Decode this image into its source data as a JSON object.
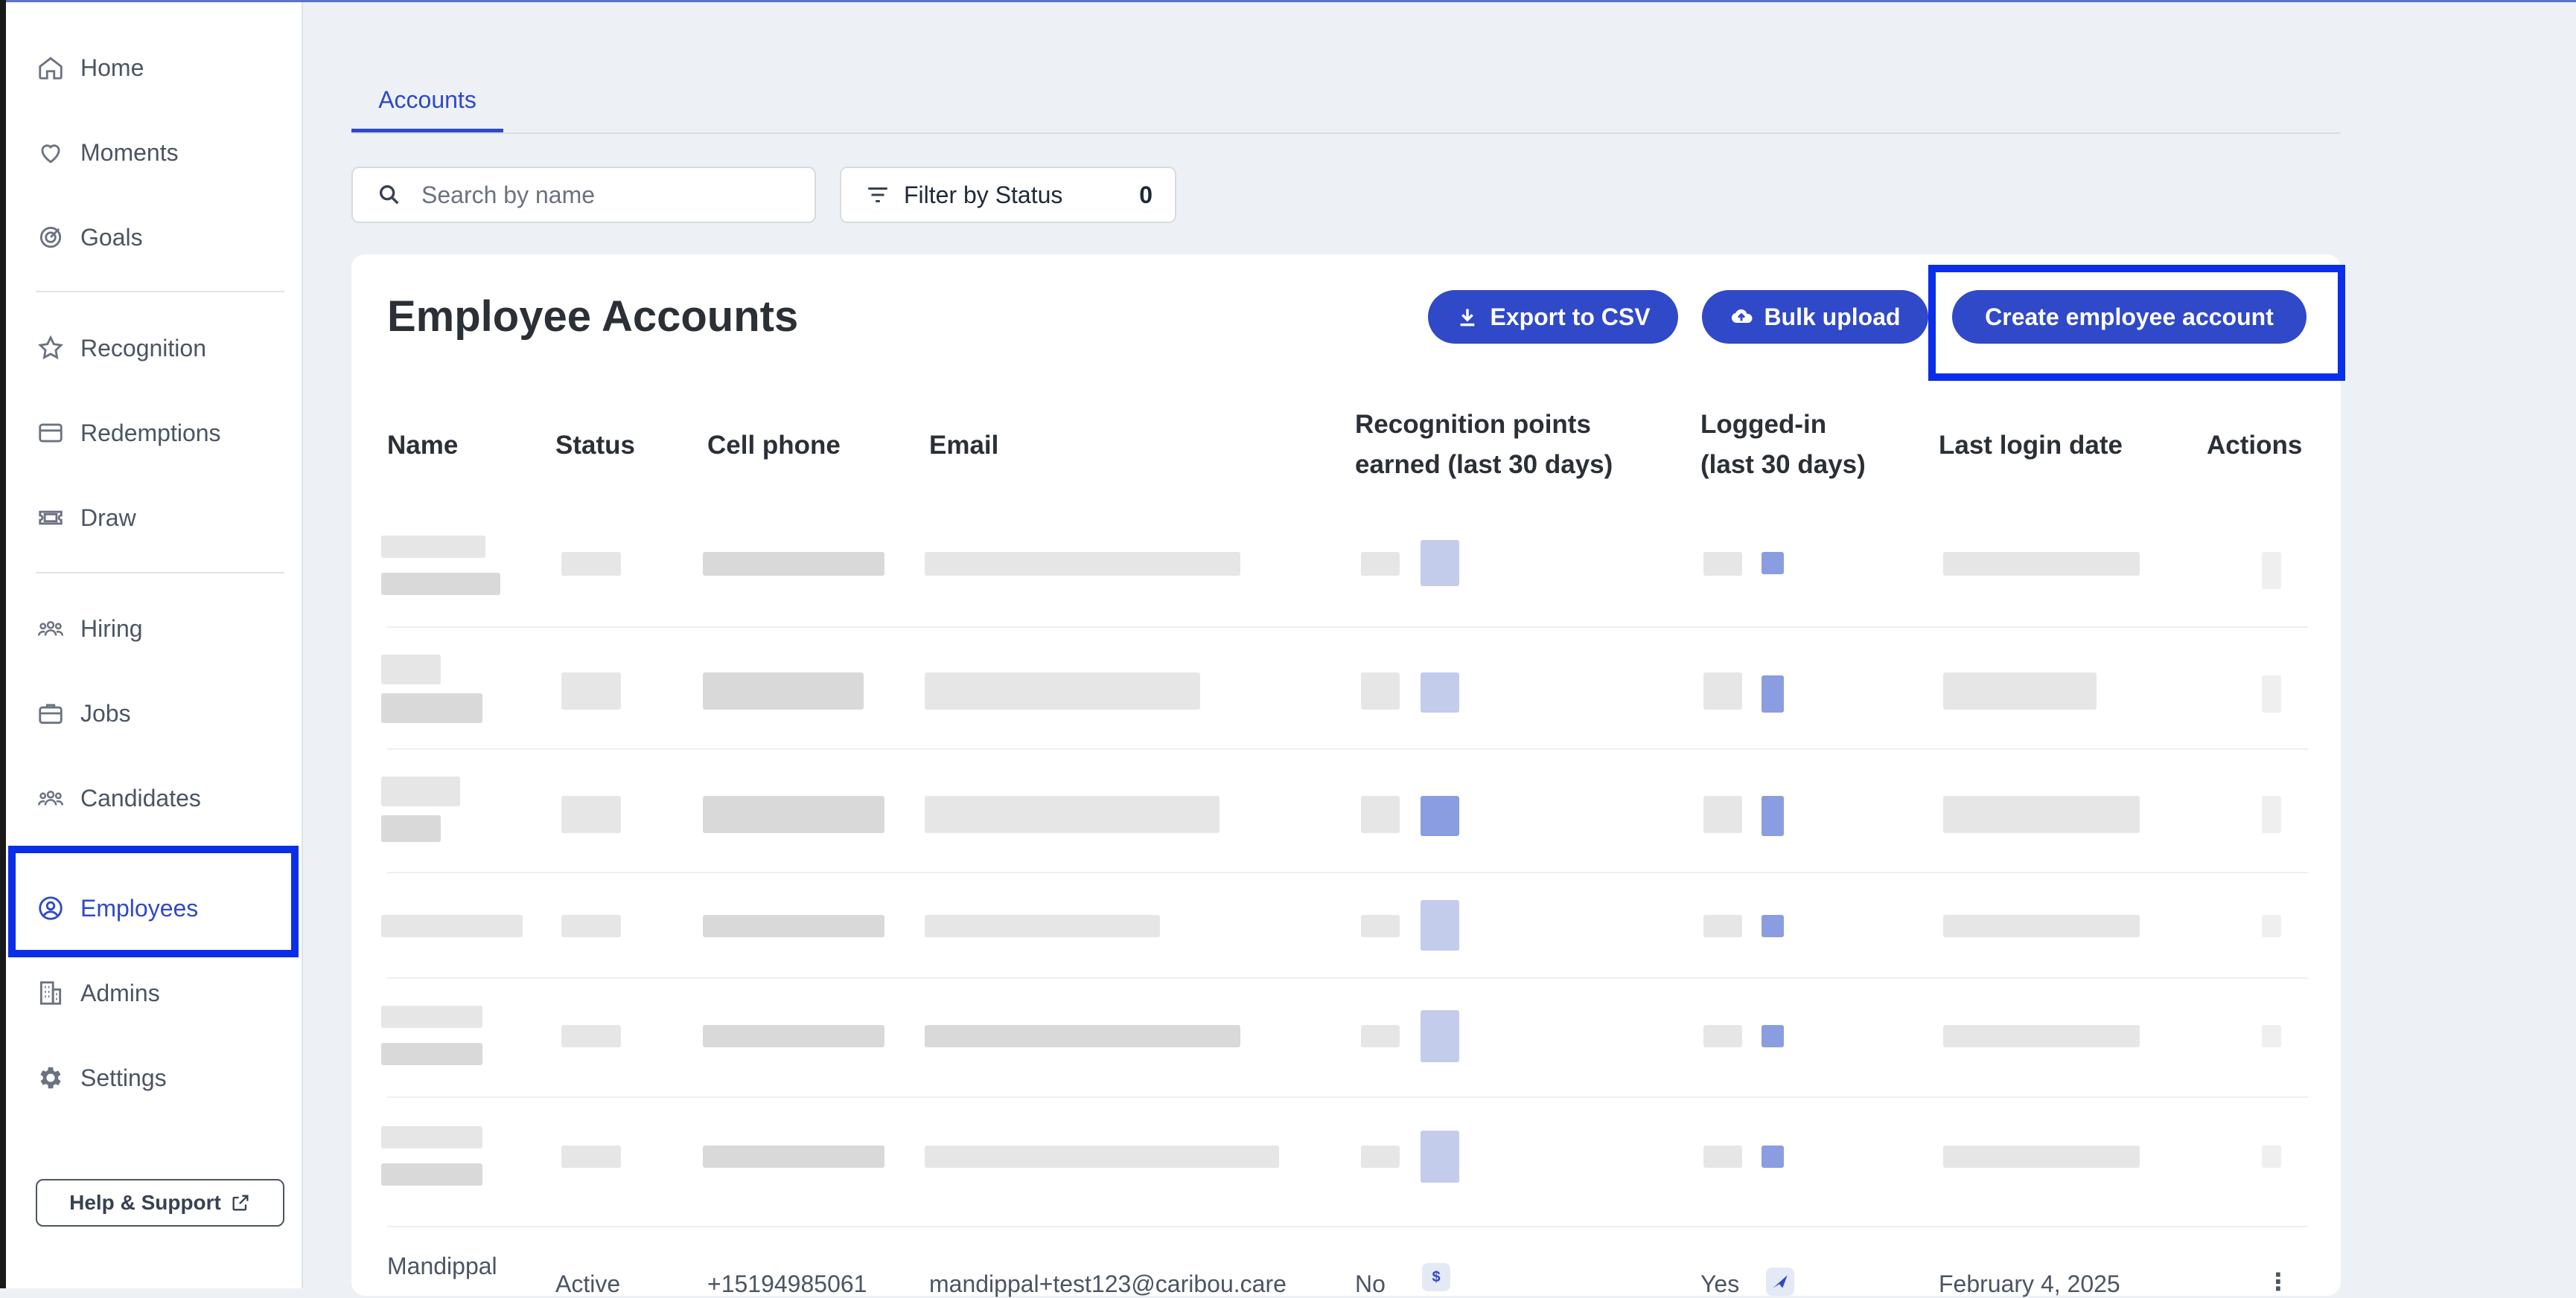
{
  "sidebar": {
    "items": [
      {
        "label": "Home",
        "icon": "home-icon"
      },
      {
        "label": "Moments",
        "icon": "heart-icon"
      },
      {
        "label": "Goals",
        "icon": "target-icon"
      },
      {
        "label": "Recognition",
        "icon": "star-icon"
      },
      {
        "label": "Redemptions",
        "icon": "card-icon"
      },
      {
        "label": "Draw",
        "icon": "ticket-icon"
      },
      {
        "label": "Hiring",
        "icon": "people-icon"
      },
      {
        "label": "Jobs",
        "icon": "briefcase-icon"
      },
      {
        "label": "Candidates",
        "icon": "people-icon"
      },
      {
        "label": "Employees",
        "icon": "user-circle-icon",
        "active": true
      },
      {
        "label": "Admins",
        "icon": "building-icon"
      },
      {
        "label": "Settings",
        "icon": "gear-icon"
      }
    ],
    "help_label": "Help & Support"
  },
  "tabs": [
    {
      "label": "Accounts",
      "active": true
    }
  ],
  "search": {
    "placeholder": "Search by name"
  },
  "filter": {
    "label": "Filter by Status",
    "count": "0"
  },
  "card": {
    "title": "Employee Accounts",
    "export_label": "Export to CSV",
    "bulk_label": "Bulk upload",
    "create_label": "Create employee account"
  },
  "table": {
    "headers": {
      "name": "Name",
      "status": "Status",
      "phone": "Cell phone",
      "email": "Email",
      "points_1": "Recognition points",
      "points_2": "earned (last 30 days)",
      "logged_1": "Logged-in",
      "logged_2": "(last 30 days)",
      "last_login": "Last login date",
      "actions": "Actions"
    },
    "visible_row": {
      "name": "Mandippal",
      "status": "Active",
      "phone": "+15194985061",
      "email": "mandippal+test123@caribou.care",
      "points": "No",
      "points_badge": "$",
      "logged_in": "Yes",
      "last_login": "February 4, 2025",
      "actions": "⋮"
    }
  },
  "colors": {
    "accent": "#2f49c8",
    "highlight_box": "#0b2ee8",
    "background": "#edf1f5"
  }
}
